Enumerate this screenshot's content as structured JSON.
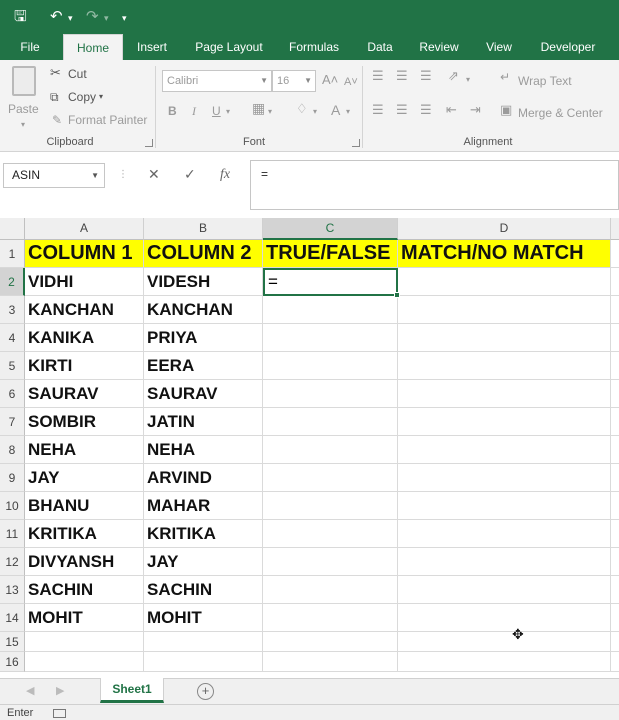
{
  "qat": {
    "save_icon": "save-icon",
    "undo_icon": "undo-icon",
    "redo_icon": "redo-icon",
    "customize_icon": "customize-qat-icon"
  },
  "tabs": [
    "File",
    "Home",
    "Insert",
    "Page Layout",
    "Formulas",
    "Data",
    "Review",
    "View",
    "Developer"
  ],
  "active_tab": "Home",
  "ribbon": {
    "clipboard": {
      "paste": "Paste",
      "cut": "Cut",
      "copy": "Copy",
      "format_painter": "Format Painter",
      "group_label": "Clipboard"
    },
    "font": {
      "font_name": "Calibri",
      "font_size": "16",
      "bold": "B",
      "italic": "I",
      "underline": "U",
      "group_label": "Font"
    },
    "alignment": {
      "wrap_text": "Wrap Text",
      "merge_center": "Merge & Center",
      "group_label": "Alignment"
    }
  },
  "formula_bar": {
    "name_box": "ASIN",
    "cancel": "✕",
    "enter": "✓",
    "fx": "fx",
    "content": "="
  },
  "columns": [
    "A",
    "B",
    "C",
    "D"
  ],
  "rows": [
    "1",
    "2",
    "3",
    "4",
    "5",
    "6",
    "7",
    "8",
    "9",
    "10",
    "11",
    "12",
    "13",
    "14",
    "15",
    "16"
  ],
  "header_row": [
    "COLUMN 1",
    "COLUMN 2",
    "TRUE/FALSE",
    "MATCH/NO MATCH"
  ],
  "table": [
    [
      "VIDHI",
      "VIDESH"
    ],
    [
      "KANCHAN",
      "KANCHAN"
    ],
    [
      "KANIKA",
      "PRIYA"
    ],
    [
      "KIRTI",
      "EERA"
    ],
    [
      "SAURAV",
      "SAURAV"
    ],
    [
      "SOMBIR",
      "JATIN"
    ],
    [
      "NEHA",
      "NEHA"
    ],
    [
      "JAY",
      "ARVIND"
    ],
    [
      "BHANU",
      "MAHAR"
    ],
    [
      "KRITIKA",
      "KRITIKA"
    ],
    [
      "DIVYANSH",
      "JAY"
    ],
    [
      "SACHIN",
      "SACHIN"
    ],
    [
      "MOHIT",
      "MOHIT"
    ]
  ],
  "active_cell": {
    "ref": "C2",
    "value": "="
  },
  "sheet_tabs": [
    "Sheet1"
  ],
  "status": {
    "mode": "Enter"
  },
  "colors": {
    "brand": "#217346",
    "header_fill": "#ffff00"
  }
}
